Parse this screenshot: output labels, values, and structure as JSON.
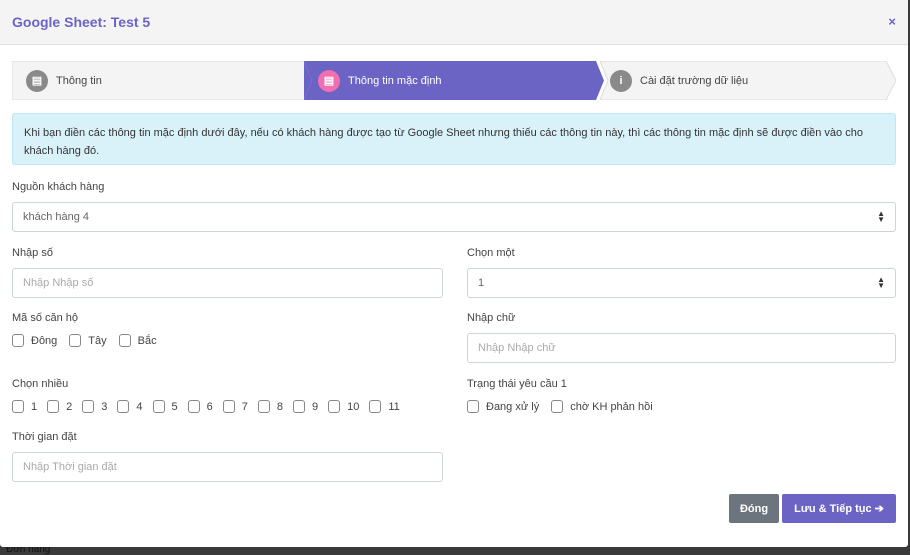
{
  "modal": {
    "title": "Google Sheet: Test 5",
    "close_label": "×"
  },
  "stepper": {
    "steps": [
      {
        "label": "Thông tin",
        "icon": "file-icon",
        "active": false
      },
      {
        "label": "Thông tin mặc định",
        "icon": "file-icon",
        "active": true
      },
      {
        "label": "Cài đặt trường dữ liệu",
        "icon": "info-icon",
        "active": false
      }
    ]
  },
  "alert": {
    "text": "Khi bạn điền các thông tin mặc định dưới đây, nếu có khách hàng được tạo từ Google Sheet nhưng thiếu các thông tin này, thì các thông tin mặc định sẽ được điền vào cho khách hàng đó."
  },
  "form": {
    "source": {
      "label": "Nguồn khách hàng",
      "value": "khách hàng 4"
    },
    "number": {
      "label": "Nhập số",
      "placeholder": "Nhập Nhập số"
    },
    "choose_one": {
      "label": "Chọn một",
      "value": "1"
    },
    "apartment": {
      "label": "Mã số căn hộ",
      "options": [
        "Đông",
        "Tây",
        "Bắc"
      ]
    },
    "text": {
      "label": "Nhập chữ",
      "placeholder": "Nhập Nhập chữ"
    },
    "multi": {
      "label": "Chọn nhiều",
      "options": [
        "1",
        "2",
        "3",
        "4",
        "5",
        "6",
        "7",
        "8",
        "9",
        "10",
        "11"
      ]
    },
    "status": {
      "label": "Trạng thái yêu cầu 1",
      "options": [
        "Đang xử lý",
        "chờ KH phản hồi"
      ]
    },
    "time": {
      "label": "Thời gian đặt",
      "placeholder": "Nhập Thời gian đặt"
    }
  },
  "buttons": {
    "close": "Đóng",
    "save_continue": "Lưu & Tiếp tục"
  },
  "background": {
    "text": "Đơn hàng"
  },
  "colors": {
    "accent": "#6b64c4",
    "active_icon": "#f06fb0",
    "inactive_icon": "#8a8a8a",
    "close_button": "#6c757d",
    "alert_bg": "#d9f2fa"
  }
}
